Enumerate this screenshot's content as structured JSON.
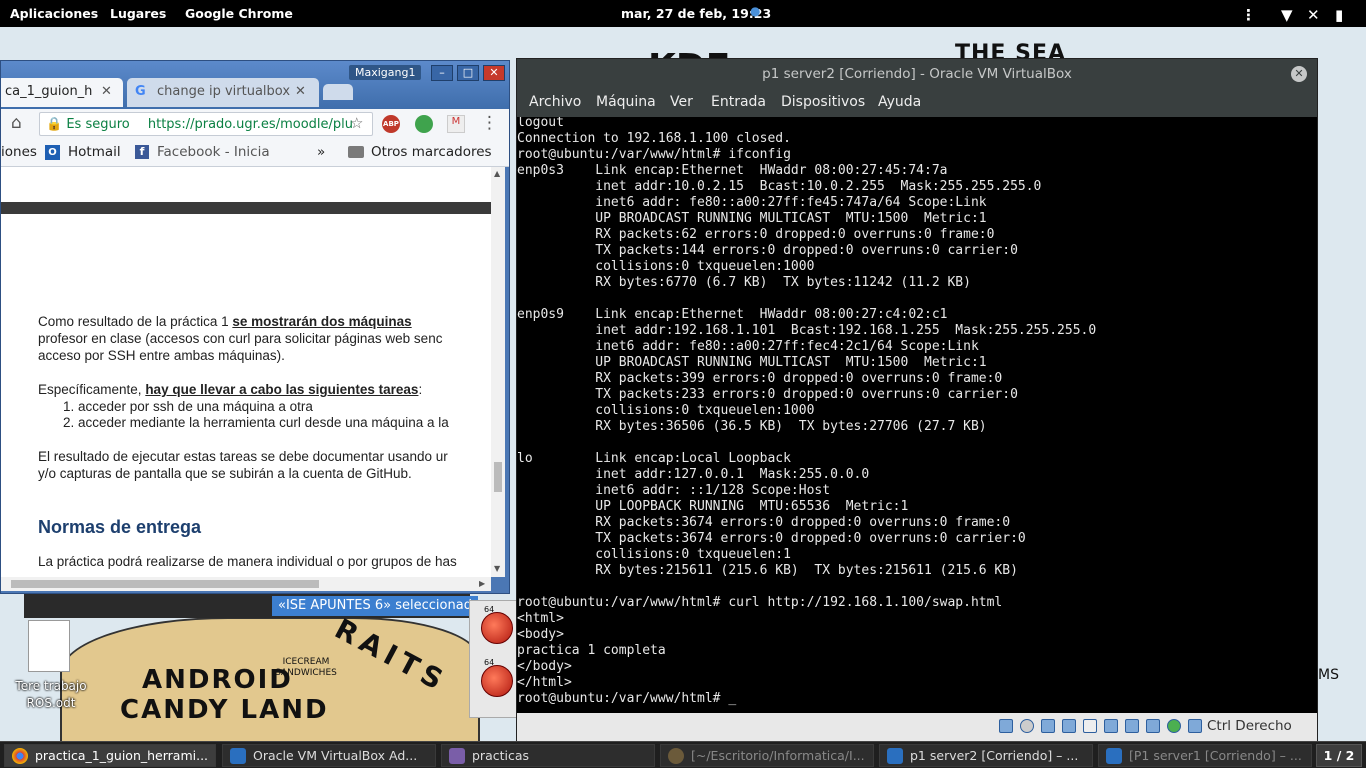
{
  "topbar": {
    "applications": "Aplicaciones",
    "places": "Lugares",
    "app_name": "Google Chrome",
    "clock": "mar, 27 de feb, 19:23"
  },
  "wallpaper": {
    "kde": "KDE",
    "sea": "THE SEA",
    "android": "ANDROID",
    "candy": "CANDY LAND",
    "icecream": "ICECREAM SANDWICHES",
    "straits": "RAITS",
    "ms": "MS"
  },
  "chrome": {
    "tabs": [
      {
        "label": "ca_1_guion_h"
      },
      {
        "label": "change ip virtualbox"
      }
    ],
    "user": "Maxigang1",
    "secure_label": "Es seguro",
    "url": "https://prado.ugr.es/moodle/plu",
    "bookmarks": [
      "iones",
      "Hotmail",
      "Facebook - Inicia",
      "»",
      "Otros marcadores"
    ],
    "content": {
      "p1_line1_a": "Como resultado de la práctica 1 ",
      "p1_line1_b": "se mostrarán dos máquinas",
      "p1_line2": "profesor en clase (accesos con curl para solicitar páginas web senc",
      "p1_line3": "acceso por SSH entre ambas máquinas).",
      "p2_a": "Específicamente, ",
      "p2_b": "hay que llevar a cabo las siguientes tareas",
      "p2_c": ":",
      "li1": "1.   acceder por ssh de una máquina a otra",
      "li2": "2.   acceder mediante la herramienta curl desde una máquina a la",
      "p3_line1": "El resultado de ejecutar estas tareas se debe documentar usando ur",
      "p3_line2": "y/o capturas de pantalla que se subirán a la cuenta de GitHub.",
      "heading": "Normas de entrega",
      "p4": "La práctica podrá realizarse de manera individual o por grupos de has"
    }
  },
  "behind_window": {
    "selected_text": "«ISE APUNTES 6» seleccionad"
  },
  "desktop_icon": {
    "label": "Tere trabajo ROS.odt"
  },
  "vbox": {
    "title": "p1 server2 [Corriendo] - Oracle VM VirtualBox",
    "menu": [
      "Archivo",
      "Máquina",
      "Ver",
      "Entrada",
      "Dispositivos",
      "Ayuda"
    ],
    "host_key": "Ctrl Derecho",
    "terminal_lines": [
      "logout",
      "Connection to 192.168.1.100 closed.",
      "root@ubuntu:/var/www/html# ifconfig",
      "enp0s3    Link encap:Ethernet  HWaddr 08:00:27:45:74:7a",
      "          inet addr:10.0.2.15  Bcast:10.0.2.255  Mask:255.255.255.0",
      "          inet6 addr: fe80::a00:27ff:fe45:747a/64 Scope:Link",
      "          UP BROADCAST RUNNING MULTICAST  MTU:1500  Metric:1",
      "          RX packets:62 errors:0 dropped:0 overruns:0 frame:0",
      "          TX packets:144 errors:0 dropped:0 overruns:0 carrier:0",
      "          collisions:0 txqueuelen:1000",
      "          RX bytes:6770 (6.7 KB)  TX bytes:11242 (11.2 KB)",
      "",
      "enp0s9    Link encap:Ethernet  HWaddr 08:00:27:c4:02:c1",
      "          inet addr:192.168.1.101  Bcast:192.168.1.255  Mask:255.255.255.0",
      "          inet6 addr: fe80::a00:27ff:fec4:2c1/64 Scope:Link",
      "          UP BROADCAST RUNNING MULTICAST  MTU:1500  Metric:1",
      "          RX packets:399 errors:0 dropped:0 overruns:0 frame:0",
      "          TX packets:233 errors:0 dropped:0 overruns:0 carrier:0",
      "          collisions:0 txqueuelen:1000",
      "          RX bytes:36506 (36.5 KB)  TX bytes:27706 (27.7 KB)",
      "",
      "lo        Link encap:Local Loopback",
      "          inet addr:127.0.0.1  Mask:255.0.0.0",
      "          inet6 addr: ::1/128 Scope:Host",
      "          UP LOOPBACK RUNNING  MTU:65536  Metric:1",
      "          RX packets:3674 errors:0 dropped:0 overruns:0 frame:0",
      "          TX packets:3674 errors:0 dropped:0 overruns:0 carrier:0",
      "          collisions:0 txqueuelen:1",
      "          RX bytes:215611 (215.6 KB)  TX bytes:215611 (215.6 KB)",
      "",
      "root@ubuntu:/var/www/html# curl http://192.168.1.100/swap.html",
      "<html>",
      "<body>",
      "practica 1 completa",
      "</body>",
      "</html>",
      "root@ubuntu:/var/www/html# _"
    ]
  },
  "taskbar": {
    "tasks": [
      {
        "label": "practica_1_guion_herrami...",
        "icon": "chrome-icon"
      },
      {
        "label": "Oracle VM VirtualBox Ad...",
        "icon": "virtualbox-icon"
      },
      {
        "label": "practicas",
        "icon": "folder-icon"
      },
      {
        "label": "[~/Escritorio/Informatica/I...",
        "icon": "sublime-icon"
      },
      {
        "label": "p1 server2 [Corriendo] – ...",
        "icon": "virtualbox-icon"
      },
      {
        "label": "[P1 server1 [Corriendo] – ...",
        "icon": "virtualbox-icon"
      }
    ],
    "pager": "1 / 2"
  },
  "colors": {
    "chrome_frame": "#4b77b4",
    "vbox_frame": "#393f3f",
    "terminal_bg": "#000000",
    "secure_green": "#0b8043",
    "heading_blue": "#1d3f6e"
  }
}
